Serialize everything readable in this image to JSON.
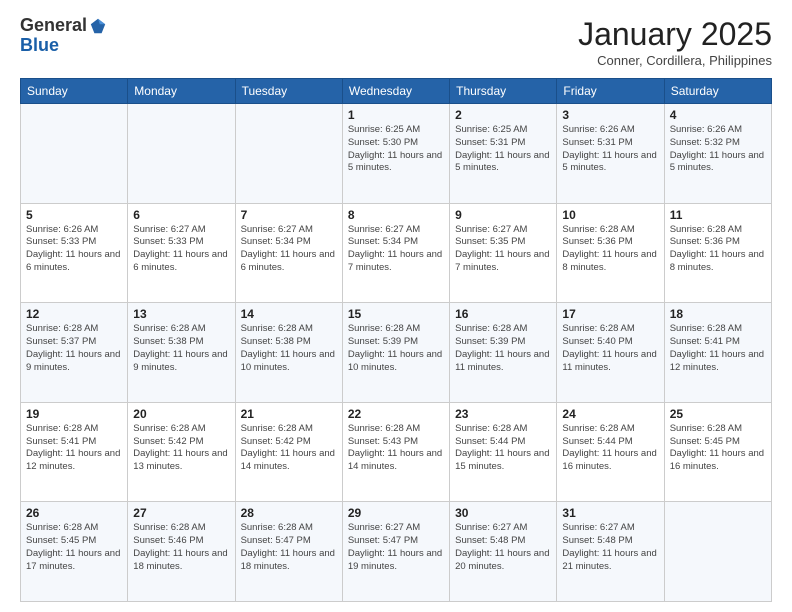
{
  "header": {
    "logo_line1": "General",
    "logo_line2": "Blue",
    "month": "January 2025",
    "location": "Conner, Cordillera, Philippines"
  },
  "weekdays": [
    "Sunday",
    "Monday",
    "Tuesday",
    "Wednesday",
    "Thursday",
    "Friday",
    "Saturday"
  ],
  "weeks": [
    [
      {
        "day": "",
        "info": ""
      },
      {
        "day": "",
        "info": ""
      },
      {
        "day": "",
        "info": ""
      },
      {
        "day": "1",
        "info": "Sunrise: 6:25 AM\nSunset: 5:30 PM\nDaylight: 11 hours and 5 minutes."
      },
      {
        "day": "2",
        "info": "Sunrise: 6:25 AM\nSunset: 5:31 PM\nDaylight: 11 hours and 5 minutes."
      },
      {
        "day": "3",
        "info": "Sunrise: 6:26 AM\nSunset: 5:31 PM\nDaylight: 11 hours and 5 minutes."
      },
      {
        "day": "4",
        "info": "Sunrise: 6:26 AM\nSunset: 5:32 PM\nDaylight: 11 hours and 5 minutes."
      }
    ],
    [
      {
        "day": "5",
        "info": "Sunrise: 6:26 AM\nSunset: 5:33 PM\nDaylight: 11 hours and 6 minutes."
      },
      {
        "day": "6",
        "info": "Sunrise: 6:27 AM\nSunset: 5:33 PM\nDaylight: 11 hours and 6 minutes."
      },
      {
        "day": "7",
        "info": "Sunrise: 6:27 AM\nSunset: 5:34 PM\nDaylight: 11 hours and 6 minutes."
      },
      {
        "day": "8",
        "info": "Sunrise: 6:27 AM\nSunset: 5:34 PM\nDaylight: 11 hours and 7 minutes."
      },
      {
        "day": "9",
        "info": "Sunrise: 6:27 AM\nSunset: 5:35 PM\nDaylight: 11 hours and 7 minutes."
      },
      {
        "day": "10",
        "info": "Sunrise: 6:28 AM\nSunset: 5:36 PM\nDaylight: 11 hours and 8 minutes."
      },
      {
        "day": "11",
        "info": "Sunrise: 6:28 AM\nSunset: 5:36 PM\nDaylight: 11 hours and 8 minutes."
      }
    ],
    [
      {
        "day": "12",
        "info": "Sunrise: 6:28 AM\nSunset: 5:37 PM\nDaylight: 11 hours and 9 minutes."
      },
      {
        "day": "13",
        "info": "Sunrise: 6:28 AM\nSunset: 5:38 PM\nDaylight: 11 hours and 9 minutes."
      },
      {
        "day": "14",
        "info": "Sunrise: 6:28 AM\nSunset: 5:38 PM\nDaylight: 11 hours and 10 minutes."
      },
      {
        "day": "15",
        "info": "Sunrise: 6:28 AM\nSunset: 5:39 PM\nDaylight: 11 hours and 10 minutes."
      },
      {
        "day": "16",
        "info": "Sunrise: 6:28 AM\nSunset: 5:39 PM\nDaylight: 11 hours and 11 minutes."
      },
      {
        "day": "17",
        "info": "Sunrise: 6:28 AM\nSunset: 5:40 PM\nDaylight: 11 hours and 11 minutes."
      },
      {
        "day": "18",
        "info": "Sunrise: 6:28 AM\nSunset: 5:41 PM\nDaylight: 11 hours and 12 minutes."
      }
    ],
    [
      {
        "day": "19",
        "info": "Sunrise: 6:28 AM\nSunset: 5:41 PM\nDaylight: 11 hours and 12 minutes."
      },
      {
        "day": "20",
        "info": "Sunrise: 6:28 AM\nSunset: 5:42 PM\nDaylight: 11 hours and 13 minutes."
      },
      {
        "day": "21",
        "info": "Sunrise: 6:28 AM\nSunset: 5:42 PM\nDaylight: 11 hours and 14 minutes."
      },
      {
        "day": "22",
        "info": "Sunrise: 6:28 AM\nSunset: 5:43 PM\nDaylight: 11 hours and 14 minutes."
      },
      {
        "day": "23",
        "info": "Sunrise: 6:28 AM\nSunset: 5:44 PM\nDaylight: 11 hours and 15 minutes."
      },
      {
        "day": "24",
        "info": "Sunrise: 6:28 AM\nSunset: 5:44 PM\nDaylight: 11 hours and 16 minutes."
      },
      {
        "day": "25",
        "info": "Sunrise: 6:28 AM\nSunset: 5:45 PM\nDaylight: 11 hours and 16 minutes."
      }
    ],
    [
      {
        "day": "26",
        "info": "Sunrise: 6:28 AM\nSunset: 5:45 PM\nDaylight: 11 hours and 17 minutes."
      },
      {
        "day": "27",
        "info": "Sunrise: 6:28 AM\nSunset: 5:46 PM\nDaylight: 11 hours and 18 minutes."
      },
      {
        "day": "28",
        "info": "Sunrise: 6:28 AM\nSunset: 5:47 PM\nDaylight: 11 hours and 18 minutes."
      },
      {
        "day": "29",
        "info": "Sunrise: 6:27 AM\nSunset: 5:47 PM\nDaylight: 11 hours and 19 minutes."
      },
      {
        "day": "30",
        "info": "Sunrise: 6:27 AM\nSunset: 5:48 PM\nDaylight: 11 hours and 20 minutes."
      },
      {
        "day": "31",
        "info": "Sunrise: 6:27 AM\nSunset: 5:48 PM\nDaylight: 11 hours and 21 minutes."
      },
      {
        "day": "",
        "info": ""
      }
    ]
  ]
}
